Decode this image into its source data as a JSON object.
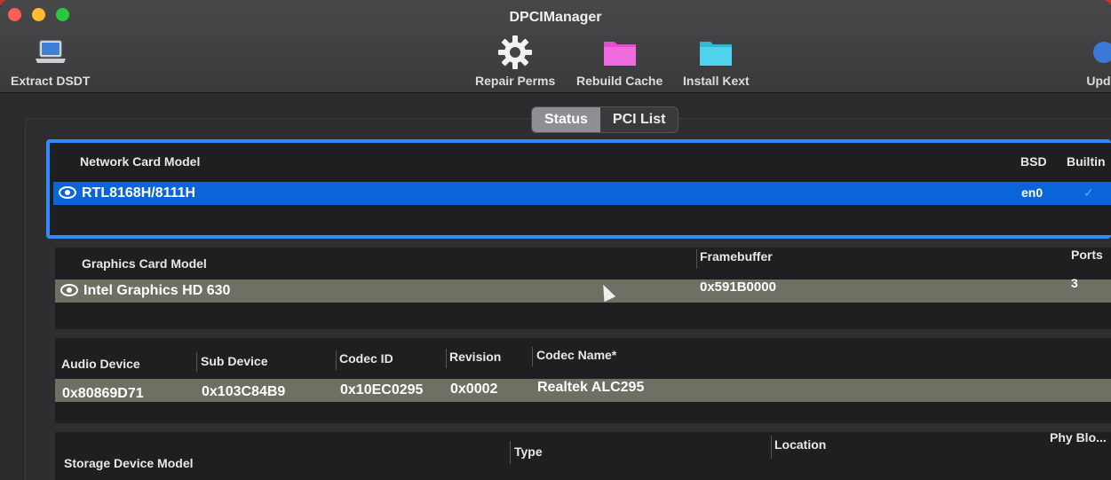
{
  "window": {
    "title": "DPCIManager"
  },
  "toolbar": {
    "extract_dsdt": "Extract DSDT",
    "repair_perms": "Repair Perms",
    "rebuild_cache": "Rebuild Cache",
    "install_kext": "Install Kext",
    "update": "Upd"
  },
  "tabs": {
    "status": "Status",
    "pci_list": "PCI List"
  },
  "network": {
    "headers": {
      "model": "Network Card Model",
      "bsd": "BSD",
      "builtin": "Builtin"
    },
    "row": {
      "model": "RTL8168H/8111H",
      "bsd": "en0",
      "builtin_checked": true
    }
  },
  "graphics": {
    "headers": {
      "model": "Graphics Card Model",
      "framebuffer": "Framebuffer",
      "ports": "Ports"
    },
    "row": {
      "model": "Intel Graphics HD 630",
      "framebuffer": "0x591B0000",
      "ports": "3"
    }
  },
  "audio": {
    "headers": {
      "device": "Audio Device",
      "sub_device": "Sub Device",
      "codec_id": "Codec ID",
      "revision": "Revision",
      "codec_name": "Codec Name*"
    },
    "row": {
      "device": "0x80869D71",
      "sub_device": "0x103C84B9",
      "codec_id": "0x10EC0295",
      "revision": "0x0002",
      "codec_name": "Realtek ALC295"
    }
  },
  "storage": {
    "headers": {
      "model": "Storage Device Model",
      "type": "Type",
      "location": "Location",
      "phy_block": "Phy Blo..."
    }
  },
  "colors": {
    "accent": "#2e8cff",
    "selection": "#0a66d8",
    "row_highlight": "#6f7064"
  }
}
